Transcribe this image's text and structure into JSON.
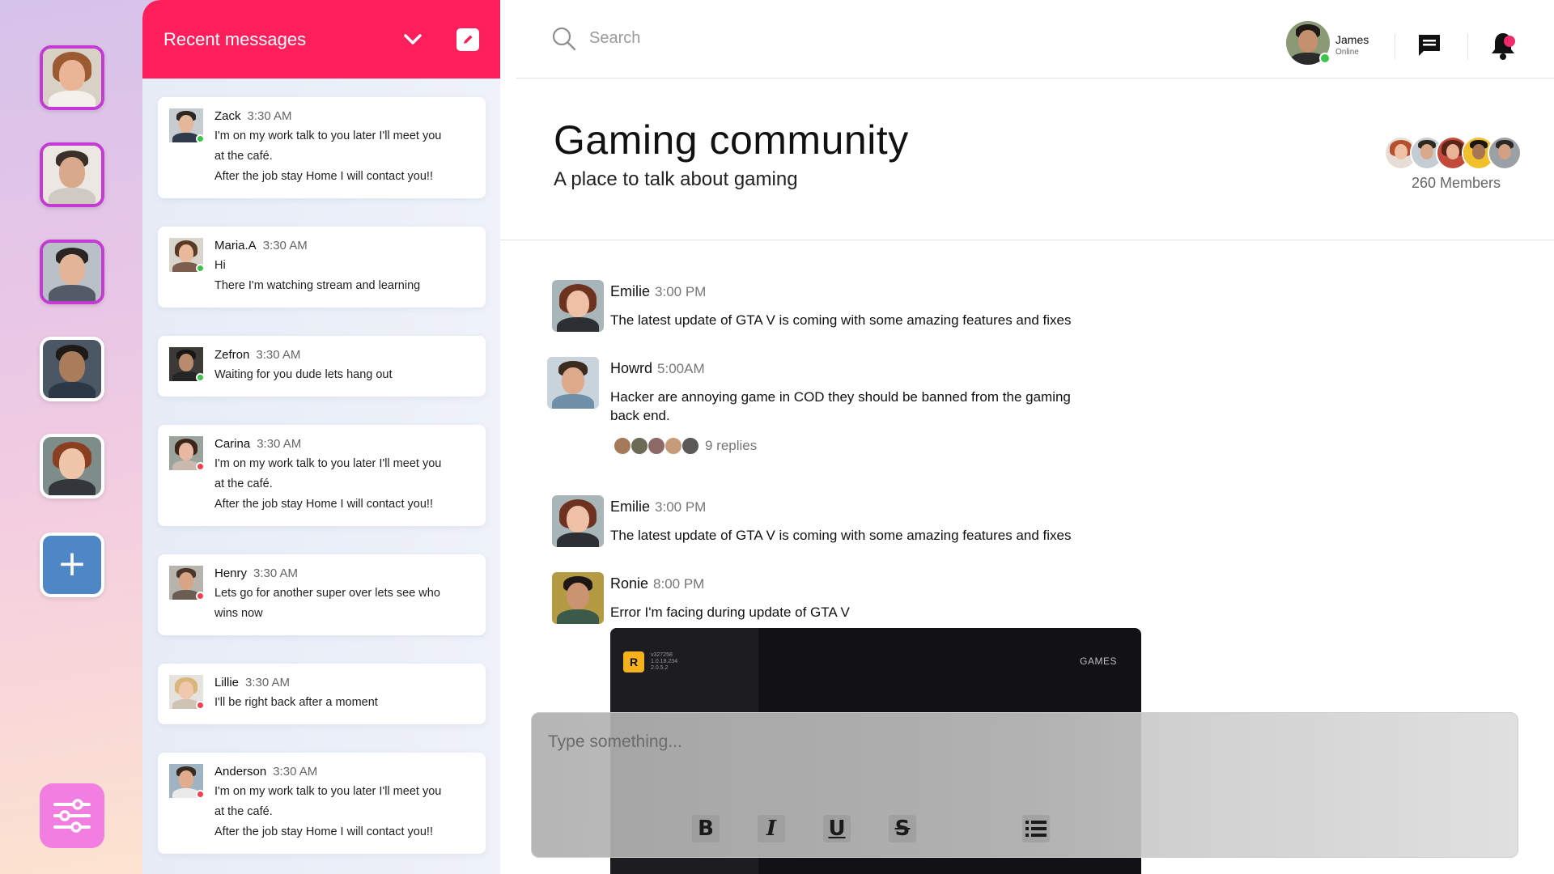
{
  "panel": {
    "title": "Recent messages",
    "cards": [
      {
        "name": "Zack",
        "time": "3:30 AM",
        "lines": [
          "I'm on my work talk to you later I'll meet you",
          "at the café.",
          "After the job stay Home I will contact you!!"
        ],
        "status_color": "#3bc44b"
      },
      {
        "name": "Maria.A",
        "time": "3:30 AM",
        "lines": [
          "Hi",
          "There I'm watching stream and learning"
        ],
        "status_color": "#3bc44b"
      },
      {
        "name": "Zefron",
        "time": "3:30 AM",
        "lines": [
          "Waiting for you dude lets hang out"
        ],
        "status_color": "#3bc44b"
      },
      {
        "name": "Carina",
        "time": "3:30 AM",
        "lines": [
          "I'm on my work talk to you later I'll meet you",
          "at the café.",
          "After the job stay Home I will contact you!!"
        ],
        "status_color": "#f0414f"
      },
      {
        "name": "Henry",
        "time": "3:30 AM",
        "lines": [
          "Lets go for another super over lets see who",
          "wins now"
        ],
        "status_color": "#f0414f"
      },
      {
        "name": "Lillie",
        "time": "3:30 AM",
        "lines": [
          "I'll be right back after a moment"
        ],
        "status_color": "#f0414f"
      },
      {
        "name": "Anderson",
        "time": "3:30 AM",
        "lines": [
          "I'm on my work talk to you later I'll meet you",
          "at the café.",
          "After the job stay Home I will contact you!!"
        ],
        "status_color": "#f0414f"
      }
    ]
  },
  "topbar": {
    "search_placeholder": "Search",
    "user_name": "James",
    "user_status": "Online"
  },
  "group": {
    "title": "Gaming community",
    "subtitle": "A place to talk about gaming",
    "members": "260 Members"
  },
  "messages": [
    {
      "name": "Emilie",
      "time": "3:00 PM",
      "text": "The latest update of GTA V is coming with some amazing features and fixes"
    },
    {
      "name": "Howrd",
      "time": "5:00AM",
      "text": "Hacker are annoying game in COD they should be banned from the gaming back end.",
      "replies": "9 replies"
    },
    {
      "name": "Emilie",
      "time": "3:00 PM",
      "text": "The latest update of GTA V is coming with some amazing features and fixes"
    },
    {
      "name": "Ronie",
      "time": "8:00 PM",
      "text": "Error I'm facing during update of GTA V"
    }
  ],
  "attachment": {
    "logo": "R",
    "version_lines": [
      "v327258",
      "1.0.18.234",
      "2.0.5.2"
    ],
    "games_label": "GAMES"
  },
  "composer": {
    "placeholder": "Type something...",
    "buttons": [
      "B",
      "I",
      "U",
      "S"
    ]
  },
  "colors": {
    "accent": "#fc1f5b",
    "rail_ring": "#c43ad3",
    "add_button": "#4f86c6",
    "settings_button": "#f17ee0",
    "online": "#3bc44b",
    "offline": "#f0414f",
    "notification": "#f02b6a"
  },
  "icons": [
    "search-icon",
    "chevron-down-icon",
    "edit-icon",
    "chat-icon",
    "bell-icon",
    "plus-icon",
    "sliders-icon",
    "list-icon"
  ]
}
